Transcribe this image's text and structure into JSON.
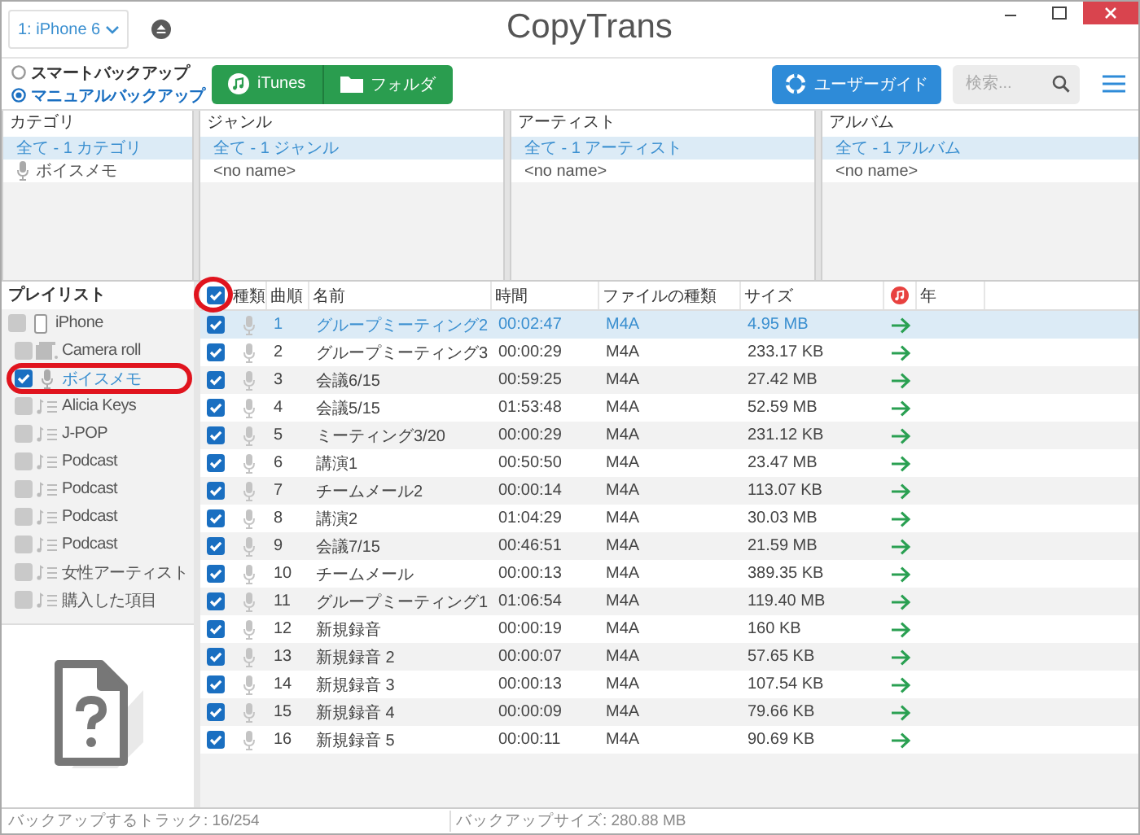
{
  "device_select": {
    "value": "1: iPhone 6"
  },
  "logo": {
    "text": "CopyTrans"
  },
  "backup_mode": [
    {
      "label": "スマートバックアップ",
      "selected": false
    },
    {
      "label": "マニュアルバックアップ",
      "selected": true
    }
  ],
  "source_buttons": [
    {
      "label": "iTunes",
      "kind": "itunes"
    },
    {
      "label": "フォルダ",
      "kind": "folder"
    }
  ],
  "guide_button": {
    "label": "ユーザーガイド"
  },
  "search": {
    "placeholder": "検索..."
  },
  "filters": [
    {
      "title": "カテゴリ",
      "items": [
        {
          "label": "全て - 1 カテゴリ",
          "kind": "plain",
          "selected": true
        },
        {
          "label": "ボイスメモ",
          "kind": "voice",
          "selected": false
        }
      ]
    },
    {
      "title": "ジャンル",
      "items": [
        {
          "label": "全て - 1 ジャンル",
          "kind": "plain",
          "selected": true
        },
        {
          "label": "<no name>",
          "kind": "plain",
          "selected": false
        }
      ]
    },
    {
      "title": "アーティスト",
      "items": [
        {
          "label": "全て - 1 アーティスト",
          "kind": "plain",
          "selected": true
        },
        {
          "label": "<no name>",
          "kind": "plain",
          "selected": false
        }
      ]
    },
    {
      "title": "アルバム",
      "items": [
        {
          "label": "全て - 1 アルバム",
          "kind": "plain",
          "selected": true
        },
        {
          "label": "<no name>",
          "kind": "plain",
          "selected": false
        }
      ]
    }
  ],
  "playlists": {
    "title": "プレイリスト",
    "items": [
      {
        "label": "iPhone",
        "kind": "device",
        "checked": false,
        "selected": false,
        "highlighted": false,
        "children": [
          {
            "label": "Camera roll",
            "kind": "photos",
            "checked": false,
            "selected": false,
            "highlighted": false
          },
          {
            "label": "ボイスメモ",
            "kind": "voice",
            "checked": true,
            "selected": true,
            "highlighted": true
          },
          {
            "label": "Alicia Keys",
            "kind": "playlist",
            "checked": false,
            "selected": false,
            "highlighted": false
          },
          {
            "label": "J-POP",
            "kind": "playlist",
            "checked": false,
            "selected": false,
            "highlighted": false
          },
          {
            "label": "Podcast",
            "kind": "playlist",
            "checked": false,
            "selected": false,
            "highlighted": false
          },
          {
            "label": "Podcast",
            "kind": "playlist",
            "checked": false,
            "selected": false,
            "highlighted": false
          },
          {
            "label": "Podcast",
            "kind": "playlist",
            "checked": false,
            "selected": false,
            "highlighted": false
          },
          {
            "label": "Podcast",
            "kind": "playlist",
            "checked": false,
            "selected": false,
            "highlighted": false
          },
          {
            "label": "女性アーティスト",
            "kind": "playlist",
            "checked": false,
            "selected": false,
            "highlighted": false
          },
          {
            "label": "購入した項目",
            "kind": "playlist",
            "checked": false,
            "selected": false,
            "highlighted": false
          }
        ]
      }
    ]
  },
  "tracks": {
    "all_checked": true,
    "all_highlighted": true,
    "columns": [
      {
        "kind": "text",
        "label": "種類"
      },
      {
        "kind": "text",
        "label": "曲順"
      },
      {
        "kind": "text",
        "label": "名前"
      },
      {
        "kind": "text",
        "label": "時間"
      },
      {
        "kind": "text",
        "label": "ファイルの種類"
      },
      {
        "kind": "text",
        "label": "サイズ"
      },
      {
        "kind": "itunes"
      },
      {
        "kind": "text",
        "label": "年"
      }
    ],
    "rows": [
      {
        "checked": true,
        "selected": true,
        "number": "1",
        "name": "グループミーティング2",
        "time": "00:02:47",
        "type": "M4A",
        "size": "4.95 MB"
      },
      {
        "checked": true,
        "selected": false,
        "number": "2",
        "name": "グループミーティング3",
        "time": "00:00:29",
        "type": "M4A",
        "size": "233.17 KB"
      },
      {
        "checked": true,
        "selected": false,
        "number": "3",
        "name": "会議6/15",
        "time": "00:59:25",
        "type": "M4A",
        "size": "27.42 MB"
      },
      {
        "checked": true,
        "selected": false,
        "number": "4",
        "name": "会議5/15",
        "time": "01:53:48",
        "type": "M4A",
        "size": "52.59 MB"
      },
      {
        "checked": true,
        "selected": false,
        "number": "5",
        "name": "ミーティング3/20",
        "time": "00:00:29",
        "type": "M4A",
        "size": "231.12 KB"
      },
      {
        "checked": true,
        "selected": false,
        "number": "6",
        "name": "講演1",
        "time": "00:50:50",
        "type": "M4A",
        "size": "23.47 MB"
      },
      {
        "checked": true,
        "selected": false,
        "number": "7",
        "name": "チームメール2",
        "time": "00:00:14",
        "type": "M4A",
        "size": "113.07 KB"
      },
      {
        "checked": true,
        "selected": false,
        "number": "8",
        "name": "講演2",
        "time": "01:04:29",
        "type": "M4A",
        "size": "30.03 MB"
      },
      {
        "checked": true,
        "selected": false,
        "number": "9",
        "name": "会議7/15",
        "time": "00:46:51",
        "type": "M4A",
        "size": "21.59 MB"
      },
      {
        "checked": true,
        "selected": false,
        "number": "10",
        "name": "チームメール",
        "time": "00:00:13",
        "type": "M4A",
        "size": "389.35 KB"
      },
      {
        "checked": true,
        "selected": false,
        "number": "11",
        "name": "グループミーティング1",
        "time": "01:06:54",
        "type": "M4A",
        "size": "119.40 MB"
      },
      {
        "checked": true,
        "selected": false,
        "number": "12",
        "name": "新規録音",
        "time": "00:00:19",
        "type": "M4A",
        "size": "160 KB"
      },
      {
        "checked": true,
        "selected": false,
        "number": "13",
        "name": "新規録音 2",
        "time": "00:00:07",
        "type": "M4A",
        "size": "57.65 KB"
      },
      {
        "checked": true,
        "selected": false,
        "number": "14",
        "name": "新規録音 3",
        "time": "00:00:13",
        "type": "M4A",
        "size": "107.54 KB"
      },
      {
        "checked": true,
        "selected": false,
        "number": "15",
        "name": "新規録音 4",
        "time": "00:00:09",
        "type": "M4A",
        "size": "79.66 KB"
      },
      {
        "checked": true,
        "selected": false,
        "number": "16",
        "name": "新規録音 5",
        "time": "00:00:11",
        "type": "M4A",
        "size": "90.69 KB"
      }
    ]
  },
  "status_bar": {
    "tracks": "バックアップするトラック: 16/254",
    "size": "バックアップサイズ: 280.88 MB"
  }
}
